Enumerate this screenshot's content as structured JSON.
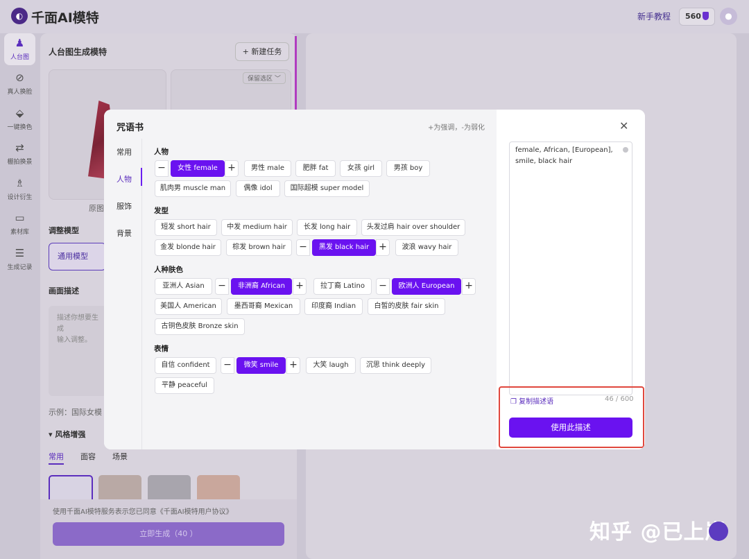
{
  "app": {
    "logo_text": "千面AI模特",
    "logo_glyph": "◐",
    "tutorial": "新手教程",
    "credits": "560",
    "avatar_glyph": "●"
  },
  "nav": [
    {
      "label": "人台图",
      "icon": "mannequin-icon",
      "glyph": "♟"
    },
    {
      "label": "真人换脸",
      "icon": "face-swap-icon",
      "glyph": "⊘"
    },
    {
      "label": "一键换色",
      "icon": "paint-bucket-icon",
      "glyph": "⬙"
    },
    {
      "label": "棚拍换景",
      "icon": "scene-icon",
      "glyph": "⇄"
    },
    {
      "label": "设计衍生",
      "icon": "shirt-icon",
      "glyph": "♗"
    },
    {
      "label": "素材库",
      "icon": "folder-icon",
      "glyph": "▭"
    },
    {
      "label": "生成记录",
      "icon": "list-icon",
      "glyph": "☰"
    }
  ],
  "panel": {
    "title": "人台图生成模特",
    "new_task": "+ 新建任务",
    "keep_area": "保留选区 ﹀",
    "original_label": "原图",
    "model_title": "调整模型",
    "model_value": "通用模型",
    "desc_title": "画面描述",
    "desc_placeholder": "描述你想要生成\n输入调整。",
    "example": "示例：国际女模 ·",
    "style_title": "▾ 风格增强",
    "style_tabs": [
      "常用",
      "面容",
      "场景"
    ],
    "agreement": "使用千面AI模特服务表示您已同意《千面AI模特用户协议》",
    "generate": "立即生成（40 ）"
  },
  "watermark": "知乎 @已上岸",
  "modal": {
    "title": "咒语书",
    "hint": "+为强调，-为弱化",
    "close": "✕",
    "tabs": [
      "常用",
      "人物",
      "服饰",
      "背景"
    ],
    "sections": [
      {
        "title": "人物",
        "chips": [
          {
            "label": "女性 female",
            "selected": true
          },
          {
            "label": "男性 male"
          },
          {
            "label": "肥胖 fat"
          },
          {
            "label": "女孩 girl"
          },
          {
            "label": "男孩 boy"
          },
          {
            "label": "肌肉男 muscle man"
          },
          {
            "label": "偶像 idol"
          },
          {
            "label": "国际超模 super model"
          }
        ]
      },
      {
        "title": "发型",
        "chips": [
          {
            "label": "短发 short hair"
          },
          {
            "label": "中发 medium hair"
          },
          {
            "label": "长发 long hair"
          },
          {
            "label": "头发过肩 hair over shoulder"
          },
          {
            "label": "金发 blonde hair"
          },
          {
            "label": "棕发 brown hair"
          },
          {
            "label": "黑发 black hair",
            "selected": true
          },
          {
            "label": "波浪 wavy hair"
          }
        ]
      },
      {
        "title": "人种肤色",
        "chips": [
          {
            "label": "亚洲人 Asian"
          },
          {
            "label": "非洲裔 African",
            "selected": true
          },
          {
            "label": "拉丁裔 Latino"
          },
          {
            "label": "欧洲人 European",
            "selected": true
          },
          {
            "label": "美国人 American"
          },
          {
            "label": "墨西哥裔 Mexican"
          },
          {
            "label": "印度裔 Indian"
          },
          {
            "label": "白皙的皮肤 fair skin"
          },
          {
            "label": "古铜色皮肤 Bronze skin"
          }
        ]
      },
      {
        "title": "表情",
        "chips": [
          {
            "label": "自信 confident"
          },
          {
            "label": "微笑 smile",
            "selected": true
          },
          {
            "label": "大笑 laugh"
          },
          {
            "label": "沉思 think deeply"
          },
          {
            "label": "平静 peaceful"
          }
        ]
      }
    ],
    "prompt": "female, African, [European], smile, black hair",
    "copy": "❐ 复制描述语",
    "count": "46 / 600",
    "use": "使用此描述"
  },
  "colors": {
    "accent": "#6a12f0",
    "highlight": "#e0473d"
  }
}
